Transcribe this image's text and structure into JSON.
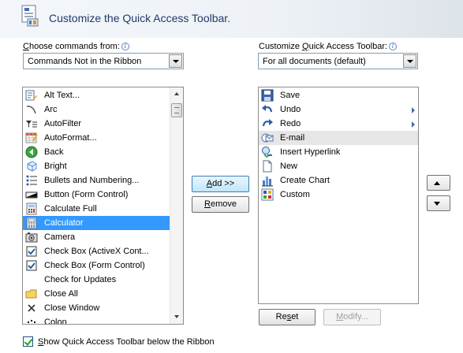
{
  "header": {
    "title": "Customize the Quick Access Toolbar."
  },
  "left": {
    "label_prefix": "",
    "label_accel": "C",
    "label_rest": "hoose commands from:",
    "combo_value": "Commands Not in the Ribbon",
    "items": [
      {
        "label": "Alt Text...",
        "icon": "alt-text-icon"
      },
      {
        "label": "Arc",
        "icon": "arc-icon"
      },
      {
        "label": "AutoFilter",
        "icon": "autofilter-icon"
      },
      {
        "label": "AutoFormat...",
        "icon": "autoformat-icon"
      },
      {
        "label": "Back",
        "icon": "back-icon"
      },
      {
        "label": "Bright",
        "icon": "bright-icon"
      },
      {
        "label": "Bullets and Numbering...",
        "icon": "bullets-icon"
      },
      {
        "label": "Button (Form Control)",
        "icon": "button-control-icon"
      },
      {
        "label": "Calculate Full",
        "icon": "calculate-full-icon"
      },
      {
        "label": "Calculator",
        "icon": "calculator-icon"
      },
      {
        "label": "Camera",
        "icon": "camera-icon"
      },
      {
        "label": "Check Box (ActiveX Cont...",
        "icon": "checkbox-activex-icon"
      },
      {
        "label": "Check Box (Form Control)",
        "icon": "checkbox-form-icon"
      },
      {
        "label": "Check for Updates",
        "icon": ""
      },
      {
        "label": "Close All",
        "icon": "close-all-icon"
      },
      {
        "label": "Close Window",
        "icon": "close-window-icon"
      },
      {
        "label": "Colon",
        "icon": "colon-icon"
      }
    ],
    "selected_index": 9
  },
  "right": {
    "label_prefix": "Customize ",
    "label_accel": "Q",
    "label_rest": "uick Access Toolbar:",
    "combo_value": "For all documents (default)",
    "items": [
      {
        "label": "Save",
        "icon": "save-icon",
        "submenu": false
      },
      {
        "label": "Undo",
        "icon": "undo-icon",
        "submenu": true
      },
      {
        "label": "Redo",
        "icon": "redo-icon",
        "submenu": true
      },
      {
        "label": "E-mail",
        "icon": "email-icon",
        "submenu": false
      },
      {
        "label": "Insert Hyperlink",
        "icon": "hyperlink-icon",
        "submenu": false
      },
      {
        "label": "New",
        "icon": "new-document-icon",
        "submenu": false
      },
      {
        "label": "Create Chart",
        "icon": "chart-icon",
        "submenu": false
      },
      {
        "label": "Custom",
        "icon": "custom-icon",
        "submenu": false
      }
    ],
    "highlighted_index": 3
  },
  "buttons": {
    "add_accel": "A",
    "add_rest": "dd >>",
    "remove_accel": "R",
    "remove_rest": "emove",
    "reset_prefix": "Re",
    "reset_accel": "s",
    "reset_rest": "et",
    "modify_prefix": "",
    "modify_accel": "M",
    "modify_rest": "odify..."
  },
  "footer": {
    "checkbox_accel": "S",
    "checkbox_rest": "how Quick Access Toolbar below the Ribbon",
    "checked": true
  },
  "colors": {
    "selection": "#3399ff",
    "title": "#1f3a6a"
  }
}
